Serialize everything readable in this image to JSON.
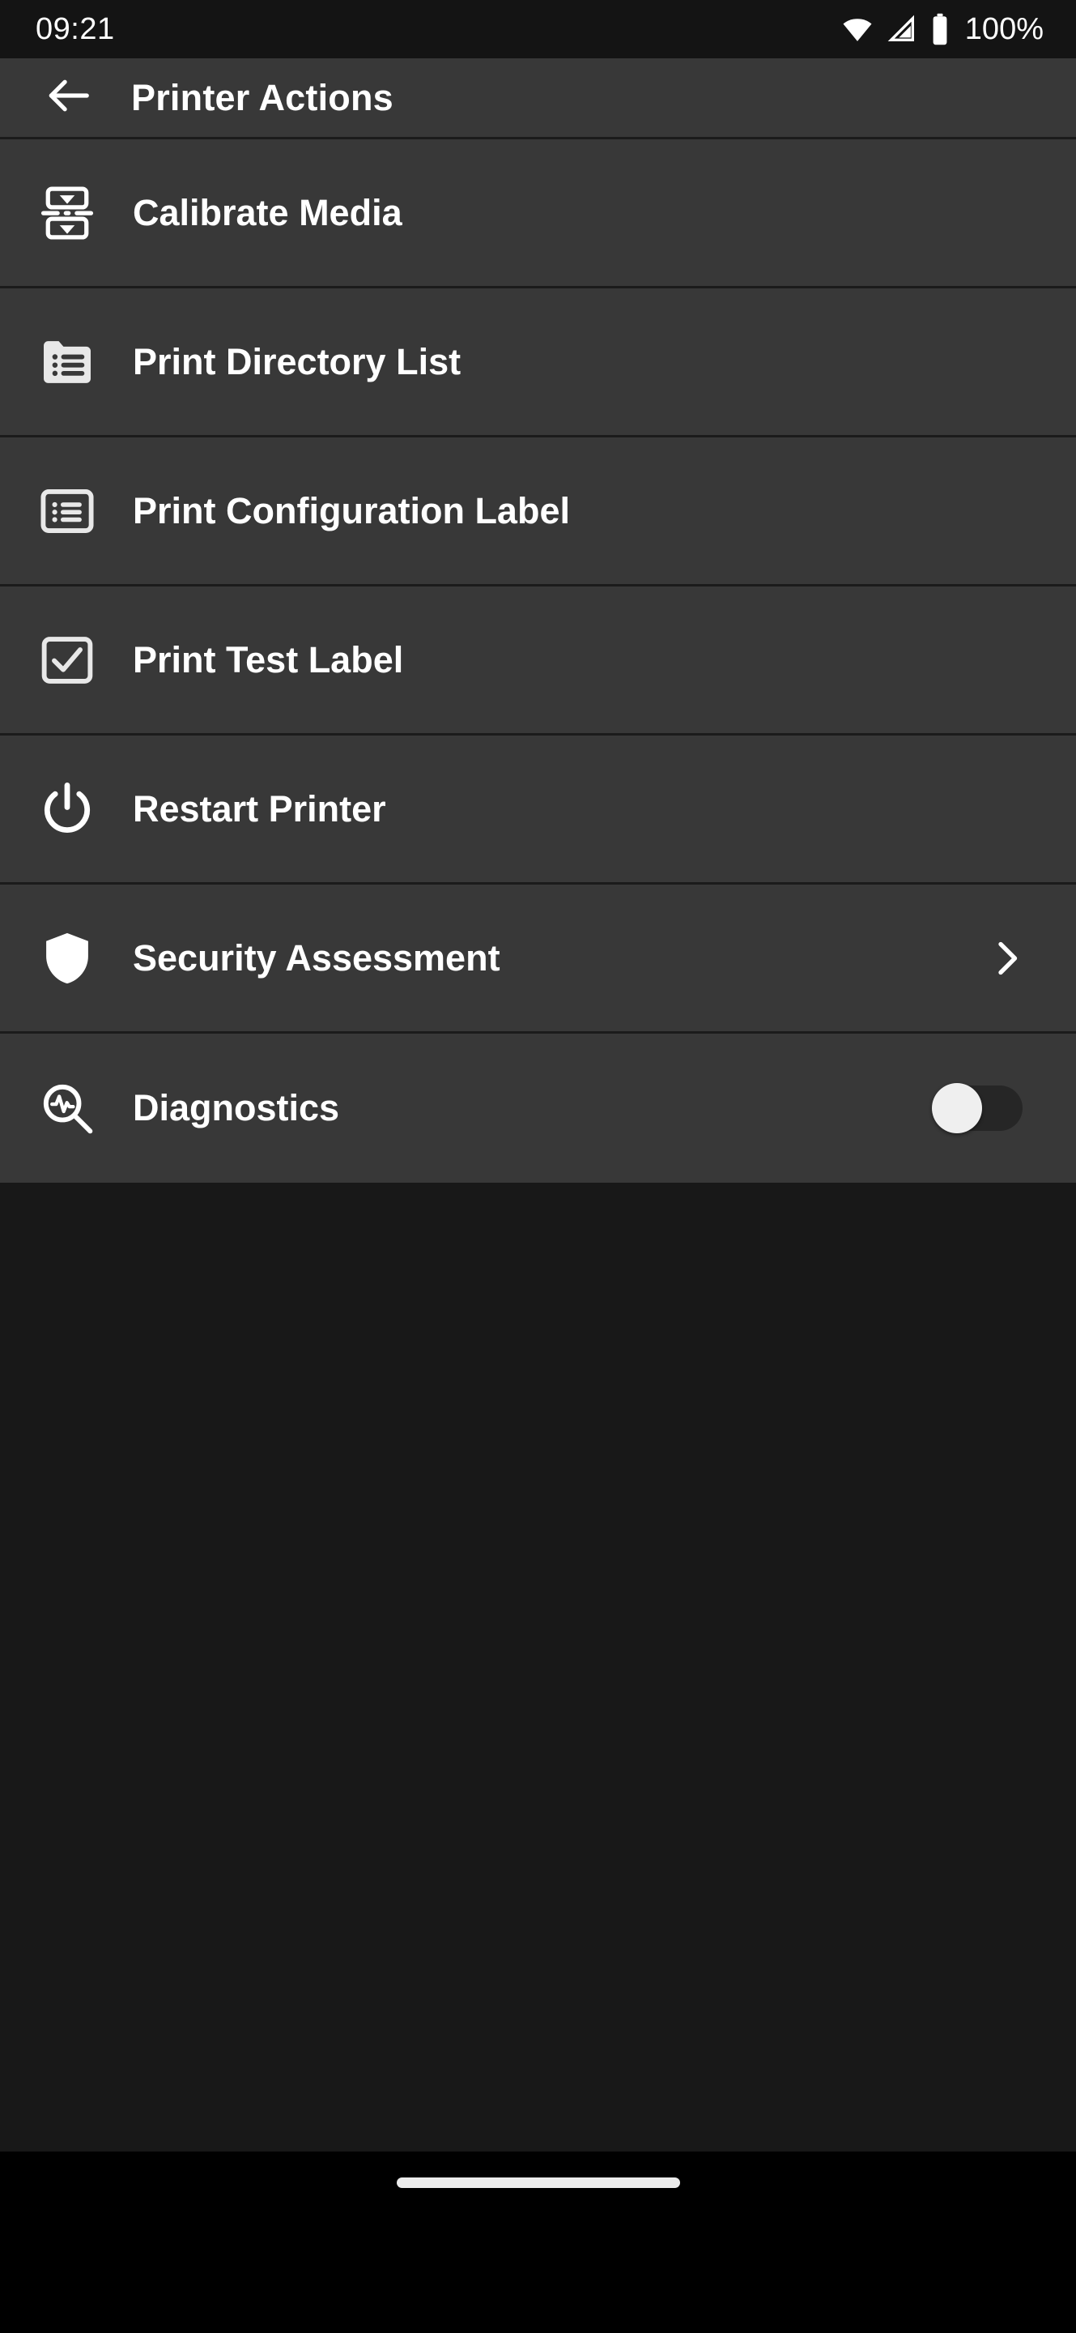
{
  "status_bar": {
    "time": "09:21",
    "battery_percent": "100%",
    "icons": [
      "wifi-icon",
      "cellular-signal-icon",
      "battery-icon"
    ]
  },
  "app_bar": {
    "back_icon": "arrow-left-icon",
    "title": "Printer Actions"
  },
  "list": {
    "items": [
      {
        "label": "Calibrate Media",
        "icon": "calibrate-media-icon",
        "accessory": "none"
      },
      {
        "label": "Print Directory List",
        "icon": "folder-list-icon",
        "accessory": "none"
      },
      {
        "label": "Print Configuration Label",
        "icon": "list-box-icon",
        "accessory": "none"
      },
      {
        "label": "Print Test Label",
        "icon": "checkbox-checked-icon",
        "accessory": "none"
      },
      {
        "label": "Restart Printer",
        "icon": "power-icon",
        "accessory": "none"
      },
      {
        "label": "Security Assessment",
        "icon": "shield-icon",
        "accessory": "chevron-right-icon"
      },
      {
        "label": "Diagnostics",
        "icon": "magnifier-pulse-icon",
        "accessory": "toggle",
        "toggle_state": "off"
      }
    ]
  },
  "nav_bar": {
    "gesture_pill": "home-gesture-pill"
  },
  "colors": {
    "status_bar_bg": "#141414",
    "surface": "#383838",
    "divider": "#1b1b1b",
    "page_bg": "#181818",
    "nav_bg": "#000000",
    "text": "#ffffff",
    "icon": "#ffffff",
    "toggle_track": "#262626",
    "toggle_knob": "#efefef"
  }
}
